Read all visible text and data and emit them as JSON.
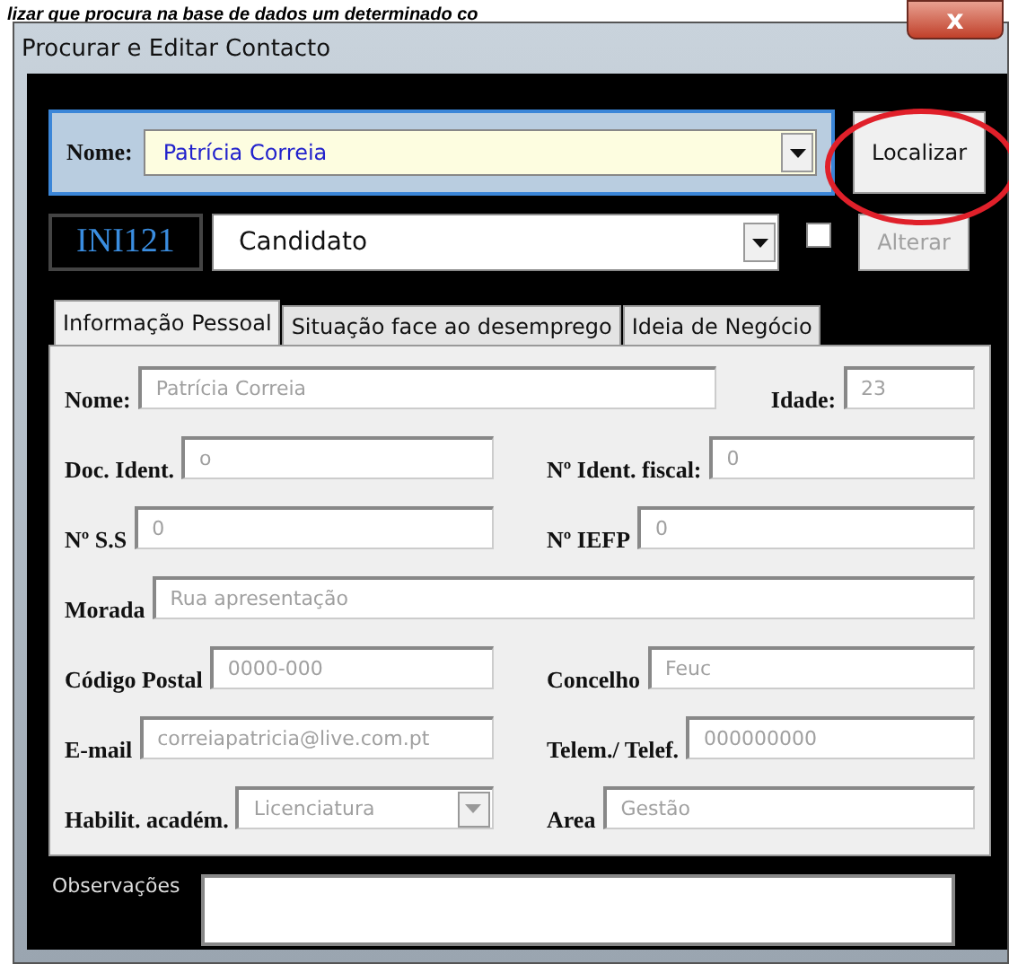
{
  "header_text": "lizar que procura na base de dados um determinado co",
  "window": {
    "title": "Procurar e Editar Contacto",
    "close_label": "x"
  },
  "search": {
    "label": "Nome:",
    "value": "Patrícia Correia",
    "button": "Localizar",
    "annotated": true
  },
  "record": {
    "code": "INI121",
    "type": "Candidato",
    "checked": false,
    "button": "Alterar",
    "button_disabled": true
  },
  "tabs": [
    {
      "label": "Informação Pessoal",
      "selected": true
    },
    {
      "label": "Situação face ao desemprego",
      "selected": false
    },
    {
      "label": "Ideia de Negócio",
      "selected": false
    }
  ],
  "rows": [
    [
      {
        "label": "Nome:",
        "value": "Patrícia Correia",
        "kind": "text"
      },
      {
        "label": "Idade:",
        "value": "23",
        "kind": "text"
      }
    ],
    [
      {
        "label": "Doc. Ident.",
        "value": "o",
        "kind": "text"
      },
      {
        "label": "Nº Ident. fiscal:",
        "value": "0",
        "kind": "text"
      }
    ],
    [
      {
        "label": "Nº S.S",
        "value": "0",
        "kind": "text"
      },
      {
        "label": "Nº IEFP",
        "value": "0",
        "kind": "text"
      }
    ],
    [
      {
        "label": "Morada",
        "value": "Rua apresentação",
        "kind": "text"
      }
    ],
    [
      {
        "label": "Código Postal",
        "value": "0000-000",
        "kind": "text"
      },
      {
        "label": "Concelho",
        "value": "Feuc",
        "kind": "text"
      }
    ],
    [
      {
        "label": "E-mail",
        "value": "correiapatricia@live.com.pt",
        "kind": "text"
      },
      {
        "label": "Telem./ Telef.",
        "value": "000000000",
        "kind": "text"
      }
    ],
    [
      {
        "label": "Habilit.  académ.",
        "value": "Licenciatura",
        "kind": "select"
      },
      {
        "label": "Area",
        "value": "Gestão",
        "kind": "text"
      }
    ]
  ],
  "observations": {
    "label": "Observações"
  }
}
